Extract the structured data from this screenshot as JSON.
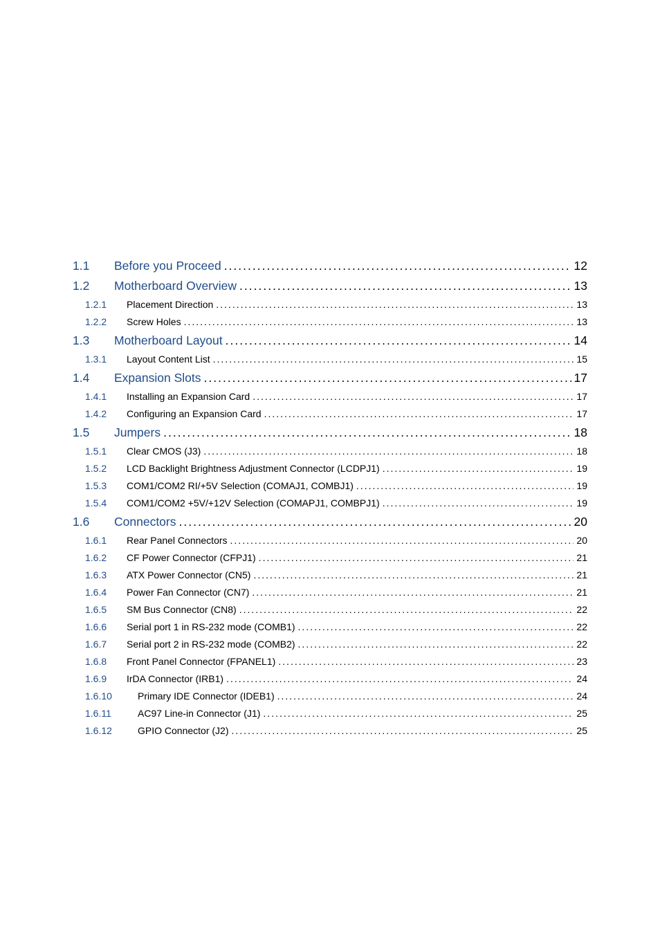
{
  "toc": [
    {
      "level": 1,
      "num": "1.1",
      "title": "Before you Proceed",
      "page": "12"
    },
    {
      "level": 1,
      "num": "1.2",
      "title": "Motherboard Overview",
      "page": "13"
    },
    {
      "level": 2,
      "num": "1.2.1",
      "title": "Placement Direction",
      "page": "13"
    },
    {
      "level": 2,
      "num": "1.2.2",
      "title": "Screw Holes",
      "page": "13"
    },
    {
      "level": 1,
      "num": "1.3",
      "title": "Motherboard Layout",
      "page": "14"
    },
    {
      "level": 2,
      "num": "1.3.1",
      "title": "Layout Content List",
      "page": "15"
    },
    {
      "level": 1,
      "num": "1.4",
      "title": "Expansion Slots",
      "page": "17"
    },
    {
      "level": 2,
      "num": "1.4.1",
      "title": "Installing an Expansion Card",
      "page": "17"
    },
    {
      "level": 2,
      "num": "1.4.2",
      "title": "Configuring an Expansion Card",
      "page": "17"
    },
    {
      "level": 1,
      "num": "1.5",
      "title": "Jumpers",
      "page": "18"
    },
    {
      "level": 2,
      "num": "1.5.1",
      "title": "Clear CMOS (J3)",
      "page": "18"
    },
    {
      "level": 2,
      "num": "1.5.2",
      "title": "LCD Backlight Brightness Adjustment Connector (LCDPJ1)",
      "page": "19"
    },
    {
      "level": 2,
      "num": "1.5.3",
      "title": "COM1/COM2 RI/+5V Selection (COMAJ1, COMBJ1)",
      "page": "19"
    },
    {
      "level": 2,
      "num": "1.5.4",
      "title": "COM1/COM2 +5V/+12V Selection (COMAPJ1, COMBPJ1)",
      "page": "19"
    },
    {
      "level": 1,
      "num": "1.6",
      "title": "Connectors",
      "page": "20"
    },
    {
      "level": 2,
      "num": "1.6.1",
      "title": "Rear Panel Connectors",
      "page": "20"
    },
    {
      "level": 2,
      "num": "1.6.2",
      "title": "CF Power Connector (CFPJ1)",
      "page": "21"
    },
    {
      "level": 2,
      "num": "1.6.3",
      "title": "ATX Power Connector (CN5)",
      "page": "21"
    },
    {
      "level": 2,
      "num": "1.6.4",
      "title": "Power Fan Connector (CN7)",
      "page": "21"
    },
    {
      "level": 2,
      "num": "1.6.5",
      "title": "SM Bus Connector (CN8)",
      "page": "22"
    },
    {
      "level": 2,
      "num": "1.6.6",
      "title": "Serial port 1 in RS-232 mode (COMB1)",
      "page": "22"
    },
    {
      "level": 2,
      "num": "1.6.7",
      "title": "Serial port 2 in RS-232 mode (COMB2)",
      "page": "22"
    },
    {
      "level": 2,
      "num": "1.6.8",
      "title": "Front Panel Connector (FPANEL1)",
      "page": "23"
    },
    {
      "level": 2,
      "num": "1.6.9",
      "title": "IrDA Connector (IRB1)",
      "page": "24"
    },
    {
      "level": 2,
      "num": "1.6.10",
      "title": "Primary IDE Connector (IDEB1)",
      "page": "24"
    },
    {
      "level": 2,
      "num": "1.6.11",
      "title": "AC97 Line-in Connector (J1)",
      "page": "25"
    },
    {
      "level": 2,
      "num": "1.6.12",
      "title": "GPIO Connector (J2)",
      "page": "25"
    }
  ]
}
